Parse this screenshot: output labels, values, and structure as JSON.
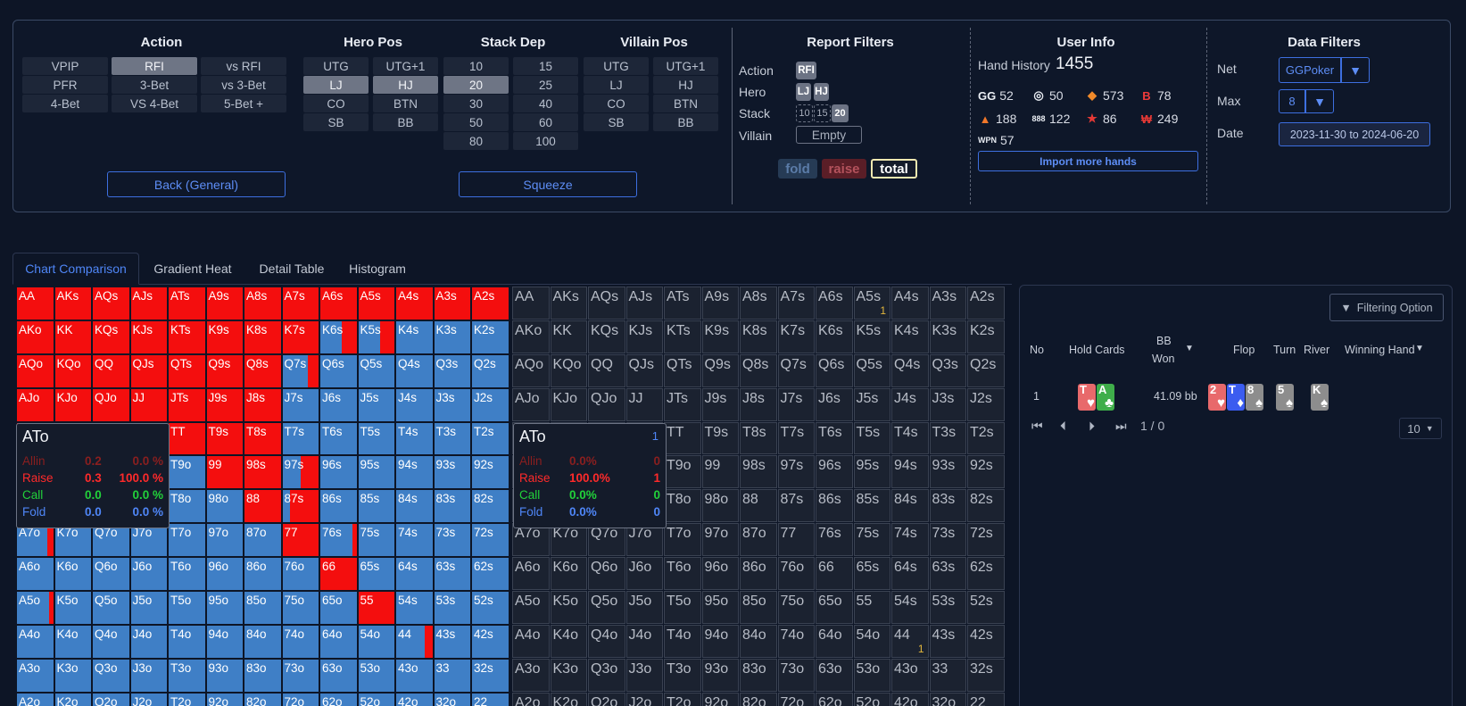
{
  "filters": {
    "sections": {
      "action": "Action",
      "hero_pos": "Hero Pos",
      "stack_dep": "Stack Dep",
      "villain_pos": "Villain Pos",
      "report": "Report Filters",
      "user": "User Info",
      "data": "Data Filters"
    },
    "action_buttons": [
      "VPIP",
      "RFI",
      "vs RFI",
      "PFR",
      "3-Bet",
      "vs 3-Bet",
      "4-Bet",
      "VS 4-Bet",
      "5-Bet +"
    ],
    "action_selected": "RFI",
    "hero_buttons": [
      "UTG",
      "UTG+1",
      "LJ",
      "HJ",
      "CO",
      "BTN",
      "SB",
      "BB"
    ],
    "hero_selected": [
      "LJ",
      "HJ"
    ],
    "stack_buttons": [
      "10",
      "15",
      "20",
      "25",
      "30",
      "40",
      "50",
      "60",
      "80",
      "100"
    ],
    "stack_selected": [
      "20"
    ],
    "villain_buttons": [
      "UTG",
      "UTG+1",
      "LJ",
      "HJ",
      "CO",
      "BTN",
      "SB",
      "BB"
    ],
    "back_label": "Back (General)",
    "squeeze_label": "Squeeze",
    "report": {
      "action_label": "Action",
      "hero_label": "Hero",
      "stack_label": "Stack",
      "villain_label": "Villain",
      "action_chip": "RFI",
      "hero_chips": [
        "LJ",
        "HJ"
      ],
      "stack_chips": [
        "10",
        "15",
        "20"
      ],
      "villain_value": "Empty",
      "fold": "fold",
      "raise": "raise",
      "total": "total"
    },
    "user": {
      "hand_history_label": "Hand History",
      "hand_history_count": "1455",
      "sites": [
        {
          "icon": "GG",
          "color": "#e9edf3",
          "count": "52"
        },
        {
          "icon": "◎",
          "color": "#e9edf3",
          "count": "50"
        },
        {
          "icon": "◆",
          "color": "#f08a2a",
          "count": "573"
        },
        {
          "icon": "B",
          "color": "#ef3b3b",
          "count": "78"
        },
        {
          "icon": "▲",
          "color": "#f0772a",
          "count": "188"
        },
        {
          "icon": "888",
          "color": "#e9edf3",
          "count": "122"
        },
        {
          "icon": "★",
          "color": "#e53935",
          "count": "86"
        },
        {
          "icon": "₩",
          "color": "#e53935",
          "count": "249"
        },
        {
          "icon": "WPN",
          "color": "#e9edf3",
          "count": "57"
        }
      ],
      "import_label": "Import more hands"
    },
    "data": {
      "net_label": "Net",
      "net_value": "GGPoker",
      "max_label": "Max",
      "max_value": "8",
      "date_label": "Date",
      "date_value": "2023-11-30 to 2024-06-20"
    }
  },
  "tabs": [
    "Chart Comparison",
    "Gradient Heat",
    "Detail Table",
    "Histogram"
  ],
  "active_tab": "Chart Comparison",
  "range_raise_fraction": [
    [
      1,
      1,
      1,
      1,
      1,
      1,
      1,
      1,
      1,
      1,
      1,
      1,
      1
    ],
    [
      1,
      1,
      1,
      1,
      1,
      1,
      1,
      1,
      0.4,
      0.4,
      0,
      0,
      0
    ],
    [
      1,
      1,
      1,
      1,
      1,
      1,
      1,
      0.3,
      0,
      0,
      0,
      0,
      0
    ],
    [
      1,
      1,
      1,
      1,
      1,
      1,
      1,
      0,
      0,
      0,
      0,
      0,
      0
    ],
    [
      1,
      1,
      1,
      1,
      1,
      1,
      1,
      0,
      0,
      0,
      0,
      0,
      0
    ],
    [
      0,
      0,
      0,
      0,
      0,
      1,
      1,
      0.5,
      0,
      0,
      0,
      0,
      0
    ],
    [
      0,
      0,
      0,
      0,
      0,
      0,
      1,
      0.8,
      0,
      0,
      0,
      0,
      0
    ],
    [
      0.15,
      0,
      0,
      0,
      0,
      0,
      0,
      1,
      0.1,
      0,
      0,
      0,
      0
    ],
    [
      0,
      0,
      0,
      0,
      0,
      0,
      0,
      0,
      1,
      0,
      0,
      0,
      0
    ],
    [
      0.1,
      0,
      0,
      0,
      0,
      0,
      0,
      0,
      0,
      1,
      0,
      0,
      0
    ],
    [
      0,
      0,
      0,
      0,
      0,
      0,
      0,
      0,
      0,
      0,
      0.2,
      0,
      0
    ],
    [
      0,
      0,
      0,
      0,
      0,
      0,
      0,
      0,
      0,
      0,
      0,
      0,
      0
    ],
    [
      0,
      0,
      0,
      0,
      0,
      0,
      0,
      0,
      0,
      0,
      0,
      0,
      0
    ]
  ],
  "hand_counts": [
    {
      "hand": "A5s",
      "count": "1"
    },
    {
      "hand": "44",
      "count": "1"
    }
  ],
  "tooltip_left": {
    "hand": "ATo",
    "rows": [
      {
        "label": "Allin",
        "a": "0.2",
        "b": "0.0 %",
        "color": "#8a1f1f"
      },
      {
        "label": "Raise",
        "a": "0.3",
        "b": "100.0 %",
        "color": "#ff2a2a"
      },
      {
        "label": "Call",
        "a": "0.0",
        "b": "0.0 %",
        "color": "#22d13a"
      },
      {
        "label": "Fold",
        "a": "0.0",
        "b": "0.0 %",
        "color": "#4f86f7"
      }
    ]
  },
  "tooltip_right": {
    "hand": "ATo",
    "num": "1",
    "rows": [
      {
        "label": "Allin",
        "a": "0.0%",
        "b": "0",
        "color": "#8a1f1f"
      },
      {
        "label": "Raise",
        "a": "100.0%",
        "b": "1",
        "color": "#ff2a2a"
      },
      {
        "label": "Call",
        "a": "0.0%",
        "b": "0",
        "color": "#22d13a"
      },
      {
        "label": "Fold",
        "a": "0.0%",
        "b": "0",
        "color": "#4f86f7"
      }
    ]
  },
  "table": {
    "filter_label": "Filtering Option",
    "headers": {
      "no": "No",
      "hold": "Hold Cards",
      "bb": "BB",
      "won": "Won",
      "flop": "Flop",
      "turn": "Turn",
      "river": "River",
      "winning": "Winning Hand"
    },
    "row": {
      "no": "1",
      "won": "41.09 bb",
      "hold": [
        {
          "rank": "T",
          "suit": "♥",
          "bg": "#e8696b"
        },
        {
          "rank": "A",
          "suit": "♣",
          "bg": "#3fae4a"
        }
      ],
      "flop": [
        {
          "rank": "2",
          "suit": "♥",
          "bg": "#e8696b"
        },
        {
          "rank": "T",
          "suit": "♦",
          "bg": "#3b5cf0"
        },
        {
          "rank": "8",
          "suit": "♠",
          "bg": "#8d8d8d"
        }
      ],
      "turn": {
        "rank": "5",
        "suit": "♠",
        "bg": "#8d8d8d"
      },
      "river": {
        "rank": "K",
        "suit": "♠",
        "bg": "#8d8d8d"
      }
    },
    "page_text": "1 / 0",
    "page_size": "10"
  },
  "colors": {
    "raise": "#f40e0e",
    "fold": "#3f7fc6",
    "accent": "#4f86f7"
  }
}
